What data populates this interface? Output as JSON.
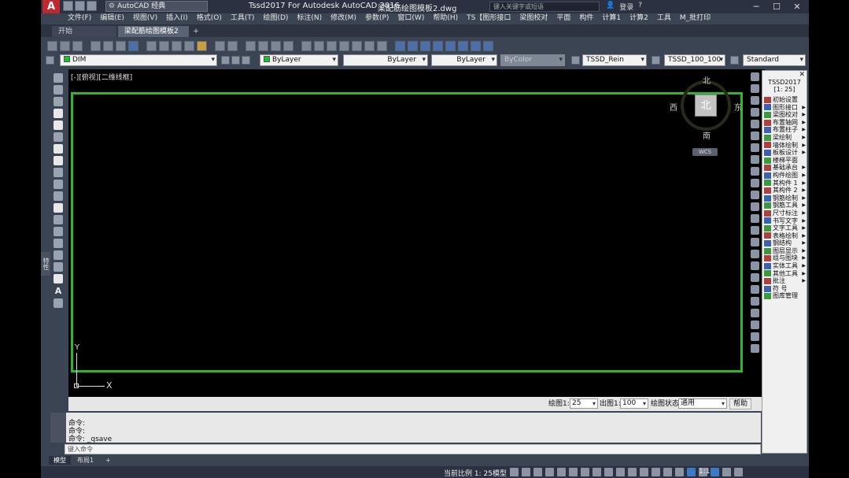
{
  "title": {
    "workspace": "AutoCAD 经典",
    "app": "Tssd2017 For Autodesk AutoCAD 2016",
    "file": "梁配筋绘图模板2.dwg",
    "search_placeholder": "键入关键字或短语",
    "user": "登录"
  },
  "menu": [
    "文件(F)",
    "编辑(E)",
    "视图(V)",
    "插入(I)",
    "格式(O)",
    "工具(T)",
    "绘图(D)",
    "标注(N)",
    "修改(M)",
    "参数(P)",
    "窗口(W)",
    "帮助(H)",
    "TS【图形接口",
    "梁图校对",
    "平面",
    "构件",
    "计算1",
    "计算2",
    "工具",
    "M_批打印"
  ],
  "tabs": {
    "start": "开始",
    "active": "梁配筋绘图模板2",
    "add": "+"
  },
  "props": {
    "layer": "DIM",
    "color": "ByLayer",
    "linetype": "ByLayer",
    "lineweight": "ByLayer",
    "plotstyle": "ByColor",
    "textstyle": "TSSD_Rein",
    "dimstyle": "TSSD_100_100",
    "tablestyle": "Standard"
  },
  "viewport": {
    "label": "[-][俯视][二维线框]",
    "cube_face": "北",
    "north": "北",
    "south": "南",
    "east": "东",
    "west": "西",
    "wcs": "WCS",
    "y_label": "Y",
    "x_label": "X"
  },
  "scalebar": {
    "plot_label": "绘图1:",
    "plot_value": "25",
    "out_label": "出图1:",
    "out_value": "100",
    "state_label": "绘图状态",
    "state_value": "通用",
    "help": "帮助"
  },
  "tssd": {
    "title": "TSSD2017",
    "scale": "[1: 25]",
    "items": [
      {
        "label": "初始设置",
        "arrow": false
      },
      {
        "label": "图形接口",
        "arrow": true
      },
      {
        "label": "梁图校对",
        "arrow": true
      },
      {
        "label": "布置轴网",
        "arrow": true
      },
      {
        "label": "布置柱子",
        "arrow": true
      },
      {
        "label": "梁绘制",
        "arrow": true
      },
      {
        "label": "墙体绘制",
        "arrow": true
      },
      {
        "label": "板板设计",
        "arrow": true
      },
      {
        "label": "楼梯平面",
        "arrow": false
      },
      {
        "label": "基础承台",
        "arrow": true
      },
      {
        "label": "构件绘图",
        "arrow": true
      },
      {
        "label": "其构件 1",
        "arrow": true
      },
      {
        "label": "其构件 2",
        "arrow": true
      },
      {
        "label": "钢筋绘制",
        "arrow": true
      },
      {
        "label": "钢筋工具",
        "arrow": true
      },
      {
        "label": "尺寸标注",
        "arrow": true
      },
      {
        "label": "书写文字",
        "arrow": true
      },
      {
        "label": "文字工具",
        "arrow": true
      },
      {
        "label": "表格绘制",
        "arrow": true
      },
      {
        "label": "钢结构",
        "arrow": true
      },
      {
        "label": "图层显示",
        "arrow": true
      },
      {
        "label": "组与图块",
        "arrow": true
      },
      {
        "label": "实体工具",
        "arrow": true
      },
      {
        "label": "其他工具",
        "arrow": true
      },
      {
        "label": "批注",
        "arrow": true
      },
      {
        "label": "符 号",
        "arrow": false
      },
      {
        "label": "图库管理",
        "arrow": false
      }
    ]
  },
  "command": {
    "lines": [
      "命令:",
      "命令:",
      "命令: _qsave"
    ],
    "input_placeholder": "键入命令"
  },
  "layout_tabs": [
    "模型",
    "布局1",
    "+"
  ],
  "status": {
    "scale": "当前比例 1: 25",
    "model": "模型",
    "zoom": "1:1"
  },
  "colors": {
    "frame": "#2fb62b",
    "layer_swatch": "#1dbf2b",
    "accent": "#c0282f"
  }
}
